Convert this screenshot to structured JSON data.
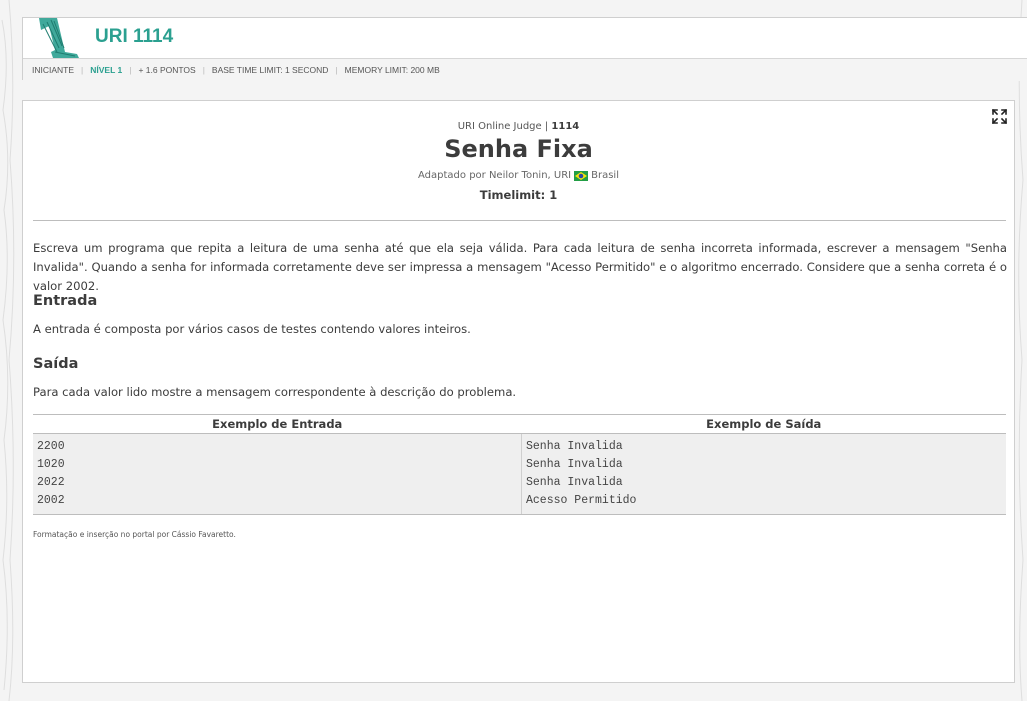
{
  "header": {
    "problem_code": "URI 1114",
    "meta": {
      "category": "INICIANTE",
      "level": "NÍVEL 1",
      "points": "+ 1.6 PONTOS",
      "time_limit": "BASE TIME LIMIT: 1 SECOND",
      "memory_limit": "MEMORY LIMIT: 200 MB"
    }
  },
  "problem": {
    "judge_prefix": "URI Online Judge | ",
    "judge_number": "1114",
    "title": "Senha Fixa",
    "author_prefix": "Adaptado por Neilor Tonin, URI",
    "country": "Brasil",
    "timelimit": "Timelimit: 1",
    "description": "Escreva um programa que repita a leitura de uma senha até que ela seja válida. Para cada leitura de senha incorreta informada, escrever a mensagem \"Senha Invalida\". Quando a senha for informada corretamente deve ser impressa a mensagem \"Acesso Permitido\" e o algoritmo encerrado. Considere que a senha correta é o valor 2002.",
    "input_title": "Entrada",
    "input_text": "A entrada é composta por vários casos de testes contendo valores inteiros.",
    "output_title": "Saída",
    "output_text": "Para cada valor lido mostre a mensagem correspondente à descrição do problema.",
    "examples": {
      "input_header": "Exemplo de Entrada",
      "output_header": "Exemplo de Saída",
      "input_lines": [
        "2200",
        "1020",
        "2022",
        "2002"
      ],
      "output_lines": [
        "Senha Invalida",
        "Senha Invalida",
        "Senha Invalida",
        "Acesso Permitido"
      ]
    },
    "credits": "Formatação e inserção no portal por Cássio Favaretto."
  },
  "colors": {
    "accent": "#2ba090",
    "text": "#3c3c3c",
    "example_bg": "#efefef"
  },
  "icons": {
    "logo": "numeral-1-logo",
    "expand": "expand-icon",
    "flag": "brazil-flag-icon"
  }
}
